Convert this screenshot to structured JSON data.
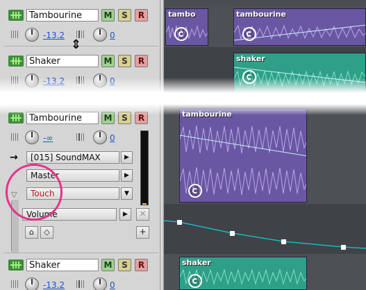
{
  "top": {
    "tracks": [
      {
        "name": "Tambourine",
        "volume": "-13.2",
        "pan": "0"
      },
      {
        "name": "Shaker",
        "volume": "-13.2",
        "pan": "0"
      }
    ],
    "buttons": {
      "mute": "M",
      "solo": "S",
      "record": "R"
    },
    "clips": [
      {
        "title": "tambo",
        "color": "#6a57a3"
      },
      {
        "title": "tambourine",
        "color": "#6a57a3"
      },
      {
        "title": "shaker",
        "color": "#2f9f87"
      }
    ]
  },
  "bottom": {
    "track": {
      "name": "Tambourine",
      "volume": "-∞",
      "pan": "0"
    },
    "buttons": {
      "mute": "M",
      "solo": "S",
      "record": "R"
    },
    "input": "[015] SoundMAX",
    "output": "Master",
    "automation_mode": "Touch",
    "envelope": "Volume",
    "remove_glyph": "✕",
    "add_glyph": "+",
    "next_track": {
      "name": "Shaker",
      "volume": "-13.2",
      "pan": "0"
    },
    "clips": [
      {
        "title": "tambourine",
        "color": "#6a57a3"
      },
      {
        "title": "shaker",
        "color": "#2f9f87"
      }
    ],
    "envelope_color": "#19b7c3",
    "highlight_color": "#e5308c"
  },
  "icons": {
    "track_eq": "eq-icon",
    "volume": "volume-icon",
    "pan": "pan-icon",
    "resize": "resize-cursor-icon",
    "loop": "loop-icon",
    "arrow": "arrow-right-icon",
    "collapse": "triangle-down-icon"
  }
}
